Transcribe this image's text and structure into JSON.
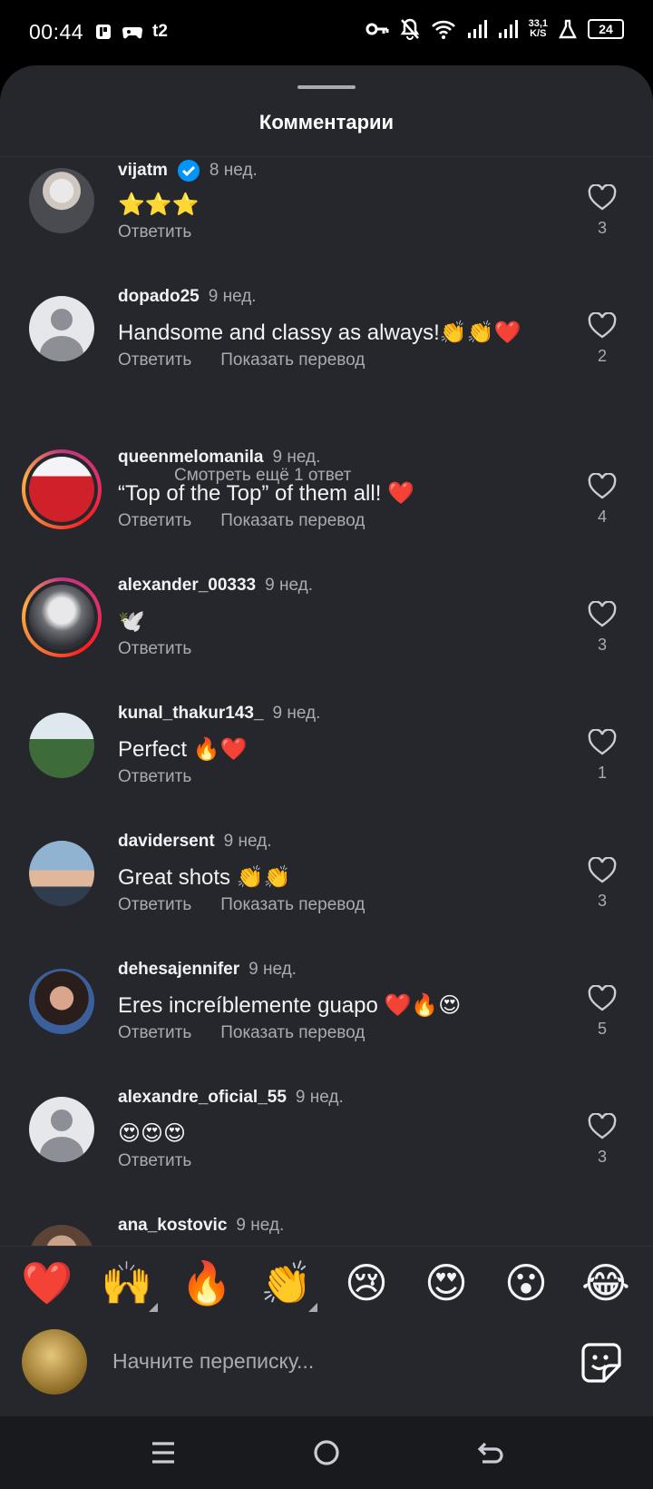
{
  "status_bar": {
    "time": "00:44",
    "left_icons": [
      "rooted-icon",
      "game-icon",
      "t2"
    ],
    "net_speed_value": "33,1",
    "net_speed_unit": "K/S",
    "battery": "24"
  },
  "sheet": {
    "title": "Комментарии"
  },
  "common": {
    "reply": "Ответить",
    "translate": "Показать перевод"
  },
  "comments": [
    {
      "user": "vijatm",
      "verified": true,
      "time": "8 нед.",
      "text": "⭐⭐⭐",
      "likes": "3",
      "translate": false
    },
    {
      "user": "dopado25",
      "verified": false,
      "time": "9 нед.",
      "text": "Handsome and classy as always!👏👏❤️",
      "likes": "2",
      "translate": true
    },
    {
      "user": "queenmelomanila",
      "verified": false,
      "time": "9 нед.",
      "text": "“Top of the Top” of them all! ❤️",
      "likes": "4",
      "translate": true
    },
    {
      "user": "alexander_00333",
      "verified": false,
      "time": "9 нед.",
      "text": "🕊️",
      "likes": "3",
      "translate": false
    },
    {
      "user": "kunal_thakur143_",
      "verified": false,
      "time": "9 нед.",
      "text": "Perfect 🔥❤️",
      "likes": "1",
      "translate": false
    },
    {
      "user": "davidersent",
      "verified": false,
      "time": "9 нед.",
      "text": "Great shots 👏👏",
      "likes": "3",
      "translate": true
    },
    {
      "user": "dehesajennifer",
      "verified": false,
      "time": "9 нед.",
      "text": "Eres increíblemente guapo ❤️🔥😍",
      "likes": "5",
      "translate": true
    },
    {
      "user": "alexandre_oficial_55",
      "verified": false,
      "time": "9 нед.",
      "text": "😍😍😍",
      "likes": "3",
      "translate": false
    },
    {
      "user": "ana_kostovic",
      "verified": false,
      "time": "9 нед.",
      "text": "",
      "likes": "",
      "translate": false
    }
  ],
  "more_replies": "Смотреть ещё 1 ответ",
  "quick_reactions": [
    "❤️",
    "🙌",
    "🔥",
    "👏",
    "😢",
    "😍",
    "😮",
    "😂"
  ],
  "composer": {
    "placeholder": "Начните переписку..."
  },
  "colors": {
    "sheet_bg": "#25272c",
    "text_primary": "#f2f3f5",
    "text_secondary": "#a8abb2",
    "verified_blue": "#0095f6",
    "nav_bg": "#191a1e"
  }
}
